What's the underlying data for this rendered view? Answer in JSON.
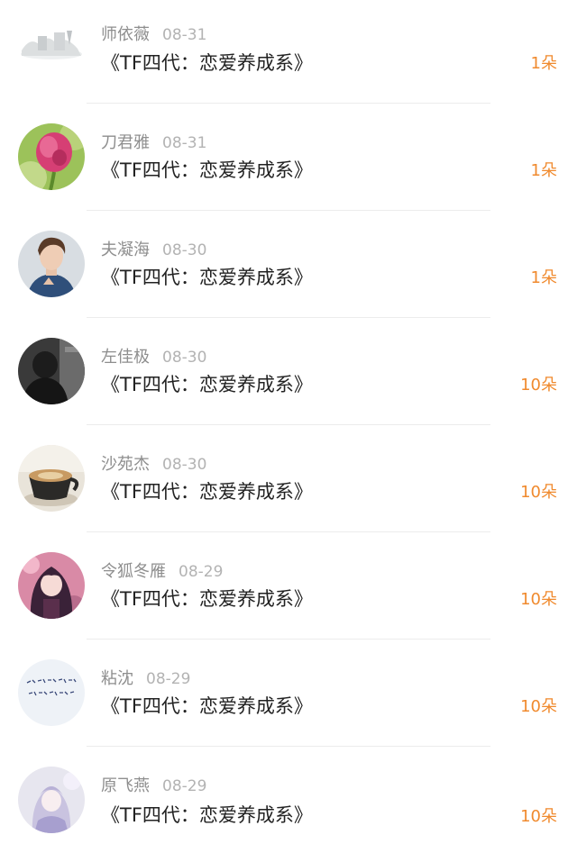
{
  "list": {
    "items": [
      {
        "name": "师依薇",
        "date": "08-31",
        "work": "《TF四代：恋爱养成系》",
        "count": "1朵",
        "avatar_icon": "landscape-avatar-icon"
      },
      {
        "name": "刀君雅",
        "date": "08-31",
        "work": "《TF四代：恋爱养成系》",
        "count": "1朵",
        "avatar_icon": "flower-avatar-icon"
      },
      {
        "name": "夫凝海",
        "date": "08-30",
        "work": "《TF四代：恋爱养成系》",
        "count": "1朵",
        "avatar_icon": "man-portrait-avatar-icon"
      },
      {
        "name": "左佳极",
        "date": "08-30",
        "work": "《TF四代：恋爱养成系》",
        "count": "10朵",
        "avatar_icon": "dark-person-avatar-icon"
      },
      {
        "name": "沙苑杰",
        "date": "08-30",
        "work": "《TF四代：恋爱养成系》",
        "count": "10朵",
        "avatar_icon": "coffee-cup-avatar-icon"
      },
      {
        "name": "令狐冬雁",
        "date": "08-29",
        "work": "《TF四代：恋爱养成系》",
        "count": "10朵",
        "avatar_icon": "anime-girl-avatar-icon"
      },
      {
        "name": "粘沈",
        "date": "08-29",
        "work": "《TF四代：恋爱养成系》",
        "count": "10朵",
        "avatar_icon": "calligraphy-avatar-icon"
      },
      {
        "name": "原飞燕",
        "date": "08-29",
        "work": "《TF四代：恋爱养成系》",
        "count": "10朵",
        "avatar_icon": "anime-character-avatar-icon"
      }
    ],
    "colors": {
      "count_accent": "#f08a2e",
      "name_gray": "#8e8e8e",
      "date_gray": "#b3b3b3",
      "title_dark": "#222222"
    }
  }
}
